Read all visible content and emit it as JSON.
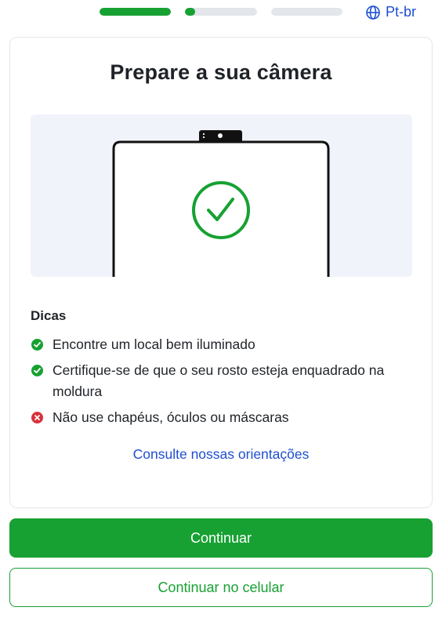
{
  "progress": [
    {
      "fill": 1.0
    },
    {
      "fill": 0.14
    },
    {
      "fill": 0.0
    }
  ],
  "language": {
    "label": "Pt-br",
    "icon": "globe-icon"
  },
  "card": {
    "title": "Prepare a sua câmera",
    "tips_heading": "Dicas",
    "tips": [
      {
        "text": "Encontre um local bem iluminado",
        "status": "ok",
        "icon": "check-circle-icon"
      },
      {
        "text": "Certifique-se de que o seu rosto esteja enquadrado na moldura",
        "status": "ok",
        "icon": "check-circle-icon"
      },
      {
        "text": "Não use chapéus, óculos ou máscaras",
        "status": "error",
        "icon": "x-circle-icon"
      }
    ],
    "guidelines_link": "Consulte nossas orientações"
  },
  "buttons": {
    "continue": "Continuar",
    "continue_mobile": "Continuar no celular"
  },
  "colors": {
    "primary": "#17a133",
    "link": "#1f4fd1",
    "error": "#d8313b",
    "illustration_bg": "#f1f3fb"
  }
}
